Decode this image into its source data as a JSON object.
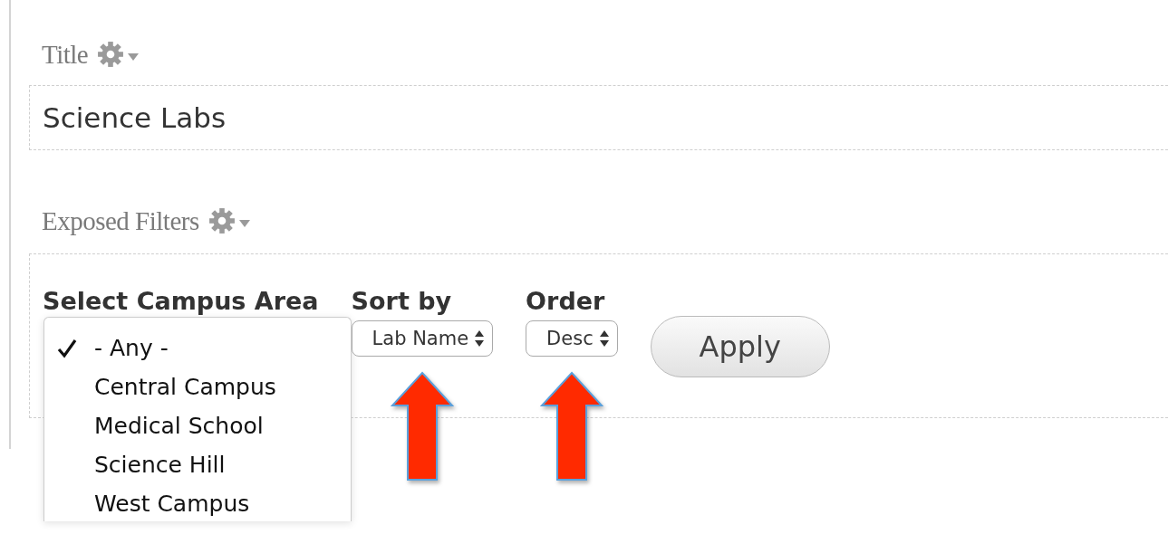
{
  "title_section": {
    "label": "Title",
    "value": "Science Labs"
  },
  "filters_section": {
    "label": "Exposed Filters",
    "filters": [
      {
        "label": "Select Campus Area",
        "expanded": true,
        "options": [
          {
            "label": "- Any -",
            "selected": true
          },
          {
            "label": "Central Campus",
            "selected": false
          },
          {
            "label": "Medical School",
            "selected": false
          },
          {
            "label": "Science Hill",
            "selected": false
          },
          {
            "label": "West Campus",
            "selected": false
          }
        ]
      },
      {
        "label": "Sort by",
        "expanded": false,
        "value": "Lab Name",
        "arrow": true
      },
      {
        "label": "Order",
        "expanded": false,
        "value": "Desc",
        "arrow": true
      }
    ],
    "apply_button": "Apply"
  }
}
